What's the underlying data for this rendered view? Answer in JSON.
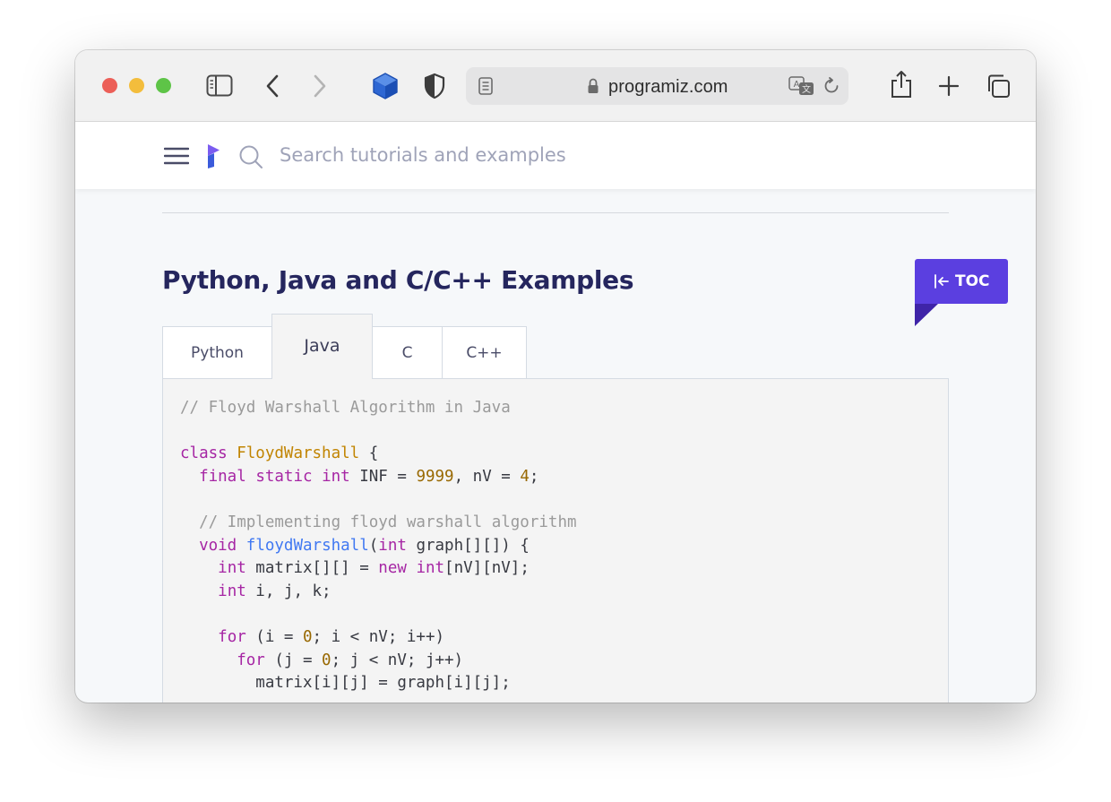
{
  "browser": {
    "url_domain": "programiz.com",
    "icons": [
      "sidebar-icon",
      "back-icon",
      "forward-icon",
      "extension-cube-icon",
      "privacy-shield-icon",
      "reader-icon",
      "lock-icon",
      "translate-icon",
      "reload-icon",
      "share-icon",
      "new-tab-icon",
      "tab-overview-icon"
    ]
  },
  "site": {
    "search_placeholder": "Search tutorials and examples"
  },
  "article": {
    "title": "Python, Java and C/C++ Examples",
    "toc_label": "TOC"
  },
  "tabs": [
    {
      "label": "Python",
      "active": false
    },
    {
      "label": "Java",
      "active": true
    },
    {
      "label": "C",
      "active": false
    },
    {
      "label": "C++",
      "active": false
    }
  ],
  "code": {
    "language": "Java",
    "lines": [
      "// Floyd Warshall Algorithm in Java",
      "",
      "class FloydWarshall {",
      "  final static int INF = 9999, nV = 4;",
      "",
      "  // Implementing floyd warshall algorithm",
      "  void floydWarshall(int graph[][]) {",
      "    int matrix[][] = new int[nV][nV];",
      "    int i, j, k;",
      "",
      "    for (i = 0; i < nV; i++)",
      "      for (j = 0; j < nV; j++)",
      "        matrix[i][j] = graph[i][j];"
    ]
  },
  "colors": {
    "accent": "#5b3fe0",
    "title": "#25265e",
    "keyword": "#a626a4",
    "class_name": "#c18401",
    "number": "#986801",
    "function": "#4078f2",
    "comment": "#9a9a9a"
  }
}
